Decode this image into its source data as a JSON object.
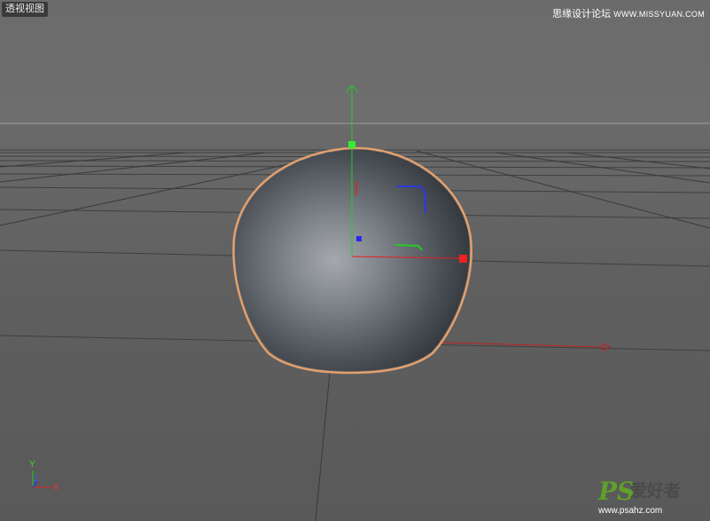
{
  "viewport": {
    "label": "透视视图"
  },
  "watermark_top": {
    "cn": "思缘设计论坛",
    "site": "WWW.MISSYUAN.COM"
  },
  "watermark_bottom": {
    "ps": "PS",
    "cn": "爱好者",
    "url": "www.psahz.com"
  },
  "world_axes": {
    "y_label": "Y",
    "z_label": "Z",
    "x_label": "X"
  },
  "colors": {
    "x_axis": "#e02020",
    "y_axis": "#22cc22",
    "z_axis": "#2a3ae0",
    "selection_outline": "#e0a070",
    "grid": "#3c3c3c",
    "horizon": "#9a9a9a"
  },
  "icons": {
    "gizmo": "move-gizmo-icon",
    "world_axes": "world-axis-icon"
  }
}
